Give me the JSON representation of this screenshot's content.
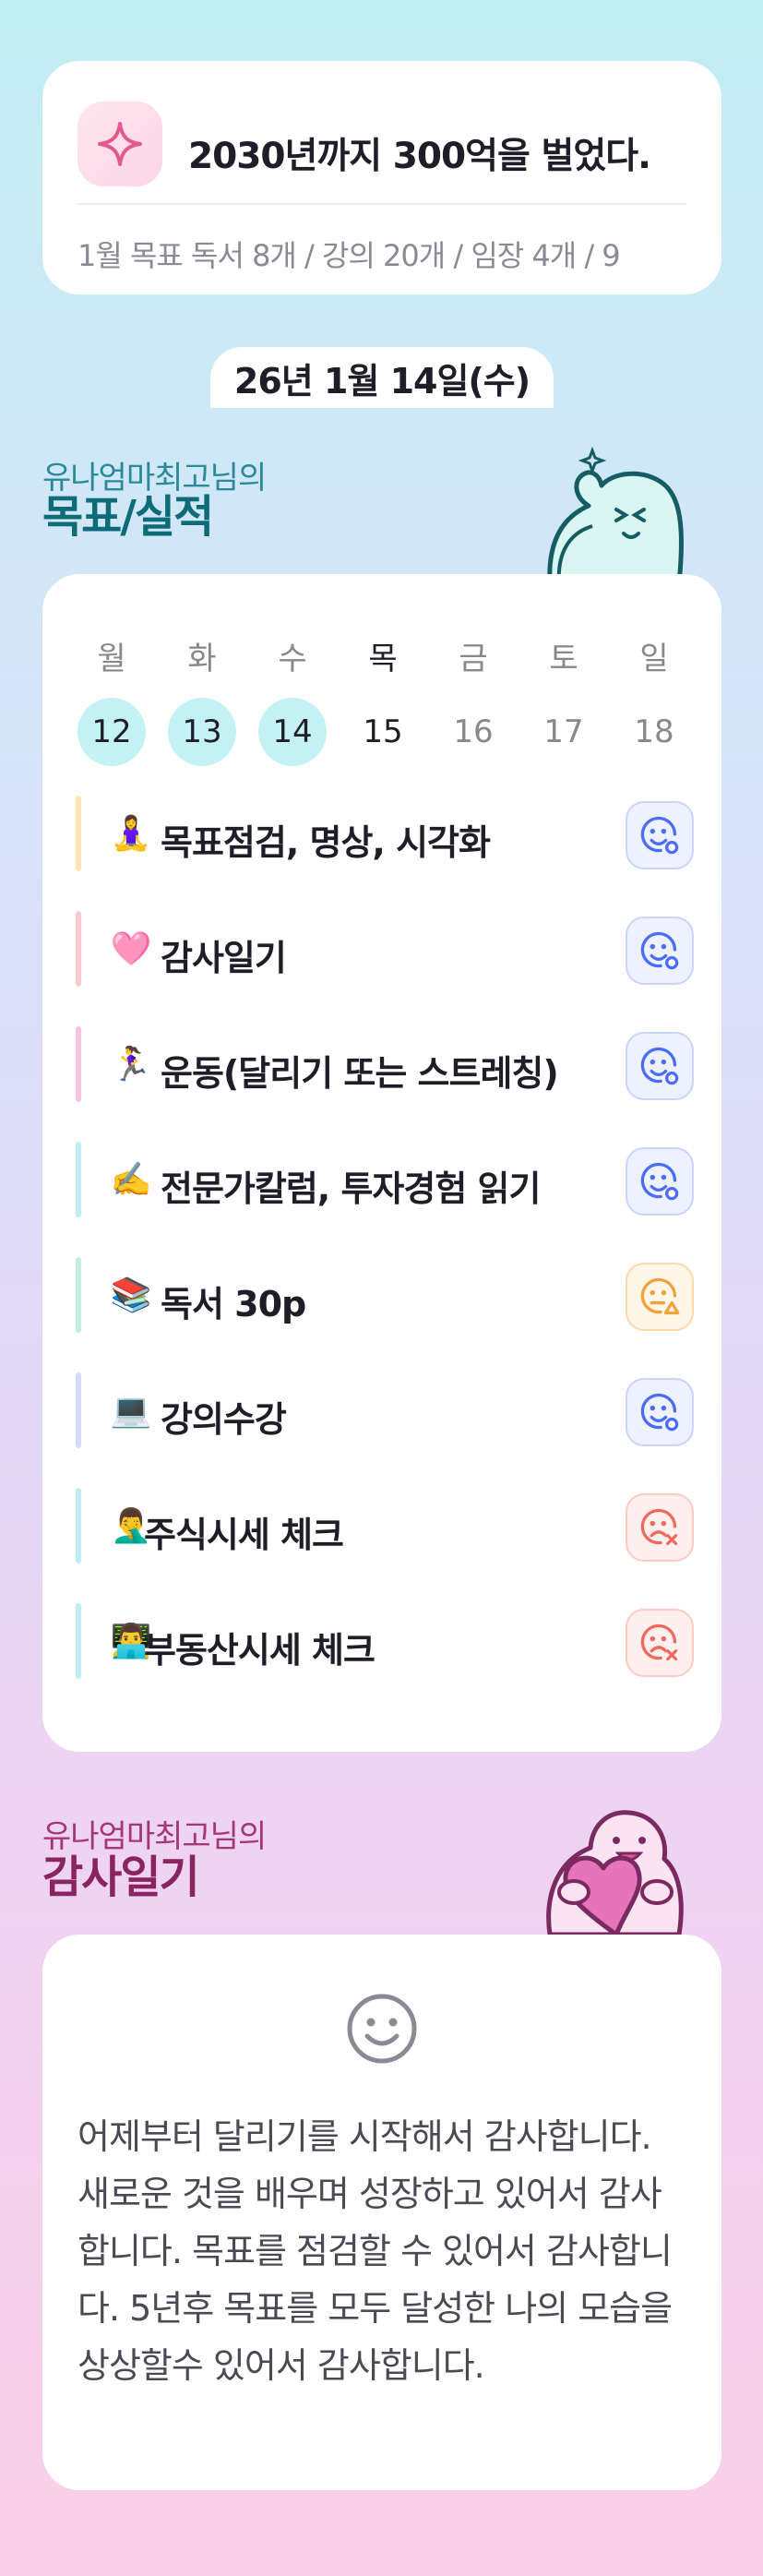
{
  "goal": {
    "title": "2030년까지 300억을 벌었다.",
    "subtitle": "1월 목표  독서 8개 / 강의 20개 / 임장 4개 / 9",
    "icon": "sparkle-icon"
  },
  "date": "26년 1월 14일(수)",
  "performance_section": {
    "subtitle": "유나엄마최고님의",
    "title": "목표/실적"
  },
  "calendar": {
    "days": [
      {
        "name": "월",
        "num": "12",
        "state": "done"
      },
      {
        "name": "화",
        "num": "13",
        "state": "done"
      },
      {
        "name": "수",
        "num": "14",
        "state": "done"
      },
      {
        "name": "목",
        "num": "15",
        "state": "today"
      },
      {
        "name": "금",
        "num": "16",
        "state": "future"
      },
      {
        "name": "토",
        "num": "17",
        "state": "future"
      },
      {
        "name": "일",
        "num": "18",
        "state": "future"
      }
    ]
  },
  "tasks": [
    {
      "emoji": "🧘‍♀️",
      "label": "목표점검, 명상, 시각화",
      "bar_color": "#fde5b3",
      "status": "good"
    },
    {
      "emoji": "🩷",
      "label": "감사일기",
      "bar_color": "#fcc9cf",
      "status": "good"
    },
    {
      "emoji": "🏃‍♀️",
      "label": "운동(달리기 또는 스트레칭)",
      "bar_color": "#f8c4e4",
      "status": "good"
    },
    {
      "emoji": "✍️",
      "label": "전문가칼럼, 투자경험 읽기",
      "bar_color": "#bfeff2",
      "status": "good"
    },
    {
      "emoji": "📚",
      "label": "독서 30p",
      "bar_color": "#c3f0db",
      "status": "mid"
    },
    {
      "emoji": "💻",
      "label": "강의수강",
      "bar_color": "#d3dafb",
      "status": "good"
    },
    {
      "emoji": "🤦‍♂️",
      "label": "주식시세 체크",
      "bar_color": "#bfeff2",
      "status": "bad"
    },
    {
      "emoji": "👨‍💻",
      "label": "부동산시세 체크",
      "bar_color": "#bfeff2",
      "status": "bad"
    }
  ],
  "status_icons": {
    "good": "smile-face-check-icon",
    "mid": "neutral-face-triangle-icon",
    "bad": "sad-face-x-icon"
  },
  "status_colors": {
    "good": "#4a6cf7",
    "mid": "#f0a23c",
    "bad": "#ef6a5e"
  },
  "thanks_section": {
    "subtitle": "유나엄마최고님의",
    "title": "감사일기",
    "mood_icon": "smile-face-icon",
    "text": "어제부터 달리기를 시작해서 감사합니다. 새로운 것을 배우며 성장하고 있어서 감사합니다. 목표를 점검할 수 있어서 감사합니다. 5년후 목표를 모두 달성한 나의 모습을 상상할수 있어서 감사합니다."
  },
  "accent_colors": {
    "teal": "#0f6b78",
    "plum": "#8a2460",
    "done_day": "#c3f1f4"
  }
}
